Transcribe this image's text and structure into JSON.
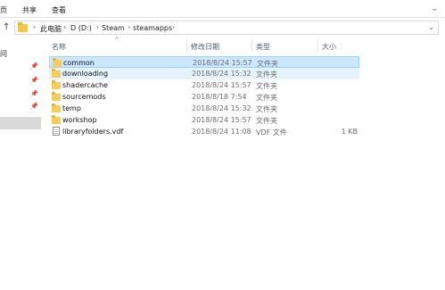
{
  "ribbon": {
    "tabs": [
      "页",
      "共享",
      "查看"
    ]
  },
  "address": {
    "crumbs": [
      "此电脑",
      "D (D:)",
      "Steam",
      "steamapps"
    ]
  },
  "nav_pane": {
    "fragment": "问"
  },
  "columns": {
    "name": "名称",
    "date": "修改日期",
    "type": "类型",
    "size": "大小"
  },
  "files": [
    {
      "name": "common",
      "date": "2018/8/24 15:57",
      "type": "文件夹",
      "size": "",
      "icon": "folder-icon"
    },
    {
      "name": "downloading",
      "date": "2018/8/24 15:32",
      "type": "文件夹",
      "size": "",
      "icon": "folder-icon"
    },
    {
      "name": "shadercache",
      "date": "2018/8/24 15:57",
      "type": "文件夹",
      "size": "",
      "icon": "folder-icon"
    },
    {
      "name": "sourcemods",
      "date": "2018/8/18 7:54",
      "type": "文件夹",
      "size": "",
      "icon": "folder-icon"
    },
    {
      "name": "temp",
      "date": "2018/8/24 15:32",
      "type": "文件夹",
      "size": "",
      "icon": "folder-icon"
    },
    {
      "name": "workshop",
      "date": "2018/8/24 15:57",
      "type": "文件夹",
      "size": "",
      "icon": "folder-icon"
    },
    {
      "name": "libraryfolders.vdf",
      "date": "2018/8/24 11:08",
      "type": "VDF 文件",
      "size": "1 KB",
      "icon": "file-icon"
    }
  ],
  "colors": {
    "selection": "#cce8ff",
    "selection_border": "#99d1ff",
    "hover": "#e5f3ff",
    "folder": "#f5cd58",
    "header_text": "#4c607a"
  }
}
